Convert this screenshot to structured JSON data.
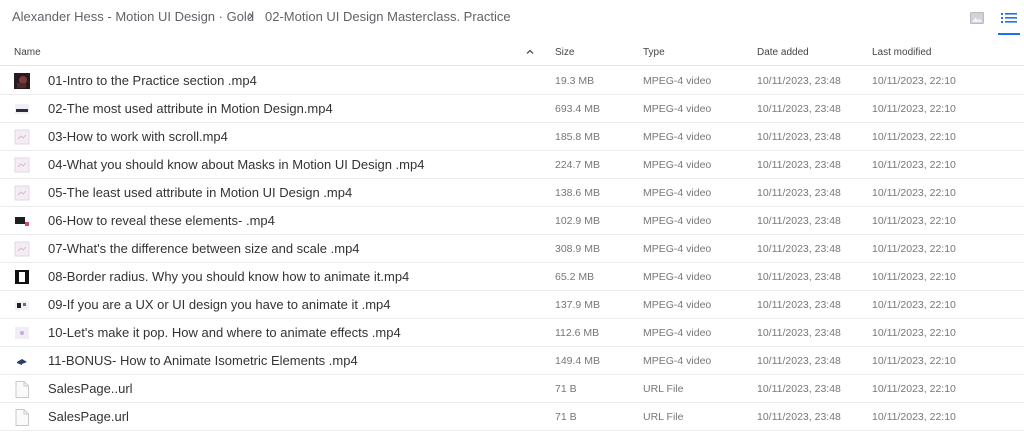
{
  "breadcrumb": {
    "parent": "Alexander Hess - Motion UI Design · Gold",
    "separator": "›",
    "current": "02-Motion UI Design Masterclass. Practice"
  },
  "toolbar": {
    "grid_view_icon": "image-icon",
    "list_view_icon": "list-icon",
    "accent_color": "#1a73e8"
  },
  "columns": {
    "name": "Name",
    "size": "Size",
    "type": "Type",
    "date_added": "Date added",
    "last_modified": "Last modified",
    "sort_icon": "chevron-up-icon"
  },
  "files": [
    {
      "name": "01-Intro to the Practice section .mp4",
      "size": "19.3 MB",
      "type": "MPEG-4 video",
      "added": "10/11/2023, 23:48",
      "modified": "10/11/2023, 22:10",
      "thumb": "video-thumb-dark"
    },
    {
      "name": "02-The most used attribute in Motion Design.mp4",
      "size": "693.4 MB",
      "type": "MPEG-4 video",
      "added": "10/11/2023, 23:48",
      "modified": "10/11/2023, 22:10",
      "thumb": "video-thumb-bar"
    },
    {
      "name": "03-How to work with scroll.mp4",
      "size": "185.8 MB",
      "type": "MPEG-4 video",
      "added": "10/11/2023, 23:48",
      "modified": "10/11/2023, 22:10",
      "thumb": "video-thumb-light"
    },
    {
      "name": "04-What you should know about Masks in Motion UI Design .mp4",
      "size": "224.7 MB",
      "type": "MPEG-4 video",
      "added": "10/11/2023, 23:48",
      "modified": "10/11/2023, 22:10",
      "thumb": "video-thumb-light"
    },
    {
      "name": "05-The least used attribute in Motion UI Design .mp4",
      "size": "138.6 MB",
      "type": "MPEG-4 video",
      "added": "10/11/2023, 23:48",
      "modified": "10/11/2023, 22:10",
      "thumb": "video-thumb-light"
    },
    {
      "name": "06-How to reveal these elements- .mp4",
      "size": "102.9 MB",
      "type": "MPEG-4 video",
      "added": "10/11/2023, 23:48",
      "modified": "10/11/2023, 22:10",
      "thumb": "video-thumb-block"
    },
    {
      "name": "07-What's the difference between size and scale .mp4",
      "size": "308.9 MB",
      "type": "MPEG-4 video",
      "added": "10/11/2023, 23:48",
      "modified": "10/11/2023, 22:10",
      "thumb": "video-thumb-light"
    },
    {
      "name": "08-Border radius. Why you should know how to animate it.mp4",
      "size": "65.2 MB",
      "type": "MPEG-4 video",
      "added": "10/11/2023, 23:48",
      "modified": "10/11/2023, 22:10",
      "thumb": "video-thumb-frame"
    },
    {
      "name": "09-If you are a UX or UI design you have to animate it .mp4",
      "size": "137.9 MB",
      "type": "MPEG-4 video",
      "added": "10/11/2023, 23:48",
      "modified": "10/11/2023, 22:10",
      "thumb": "video-thumb-grid"
    },
    {
      "name": "10-Let's make it pop. How and where to animate effects .mp4",
      "size": "112.6 MB",
      "type": "MPEG-4 video",
      "added": "10/11/2023, 23:48",
      "modified": "10/11/2023, 22:10",
      "thumb": "video-thumb-dot"
    },
    {
      "name": "11-BONUS- How to Animate Isometric Elements .mp4",
      "size": "149.4 MB",
      "type": "MPEG-4 video",
      "added": "10/11/2023, 23:48",
      "modified": "10/11/2023, 22:10",
      "thumb": "video-thumb-iso"
    },
    {
      "name": "SalesPage..url",
      "size": "71 B",
      "type": "URL File",
      "added": "10/11/2023, 23:48",
      "modified": "10/11/2023, 22:10",
      "thumb": "file-icon"
    },
    {
      "name": "SalesPage.url",
      "size": "71 B",
      "type": "URL File",
      "added": "10/11/2023, 23:48",
      "modified": "10/11/2023, 22:10",
      "thumb": "file-icon"
    }
  ]
}
